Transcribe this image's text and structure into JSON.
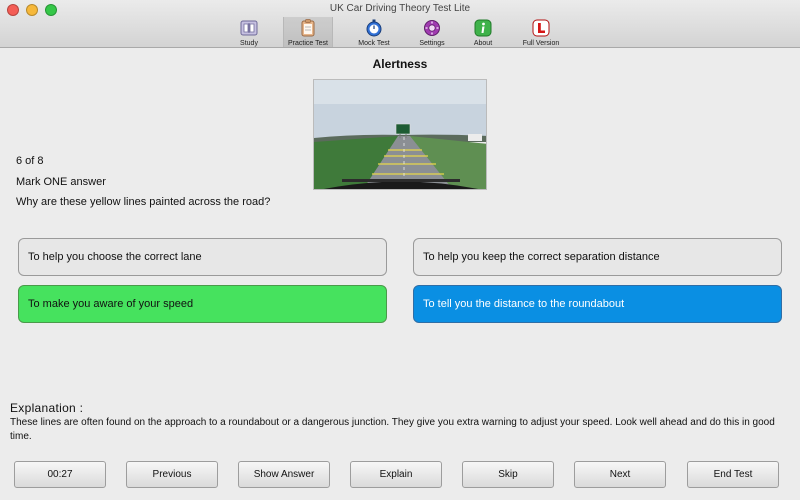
{
  "window": {
    "title": "UK Car Driving Theory Test Lite"
  },
  "toolbar": {
    "items": [
      {
        "label": "Study",
        "icon": "book-icon"
      },
      {
        "label": "Practice Test",
        "icon": "clipboard-icon"
      },
      {
        "label": "Mock Test",
        "icon": "stopwatch-icon"
      },
      {
        "label": "Settings",
        "icon": "gear-icon"
      },
      {
        "label": "About",
        "icon": "info-icon"
      },
      {
        "label": "Full Version",
        "icon": "l-plate-icon"
      }
    ],
    "selected": "Practice Test"
  },
  "question": {
    "category": "Alertness",
    "progress": "6 of 8",
    "instruction": "Mark ONE answer",
    "text": "Why are these yellow lines painted across the road?"
  },
  "answers": [
    {
      "label": "To help you choose the correct lane",
      "state": "normal"
    },
    {
      "label": "To help you keep the correct separation distance",
      "state": "normal"
    },
    {
      "label": "To make you aware of your speed",
      "state": "correct"
    },
    {
      "label": "To tell you the distance to the roundabout",
      "state": "selected"
    }
  ],
  "explanation": {
    "heading": "Explanation :",
    "text": "These lines are often found on the approach to a roundabout or a dangerous junction. They give you extra warning to adjust your speed. Look well ahead and do this in good time."
  },
  "buttons": {
    "timer": "00:27",
    "previous": "Previous",
    "show_answer": "Show Answer",
    "explain": "Explain",
    "skip": "Skip",
    "next": "Next",
    "end_test": "End Test"
  },
  "colors": {
    "correct": "#46e25e",
    "selected": "#0a8fe3"
  }
}
